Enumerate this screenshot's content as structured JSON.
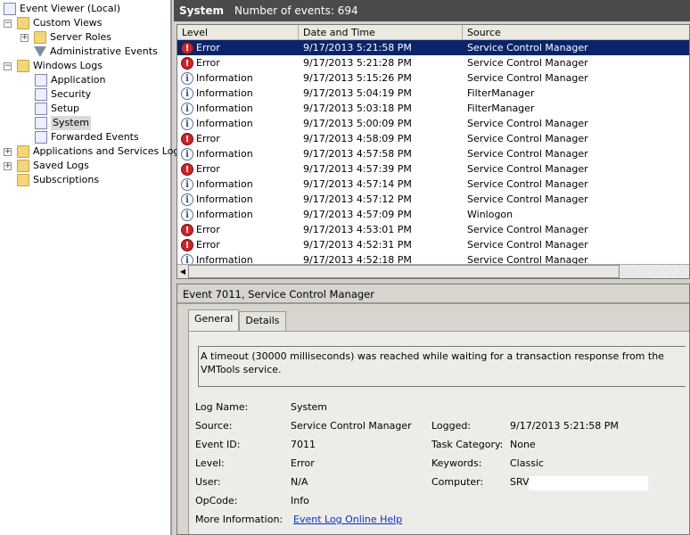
{
  "tree": {
    "root": "Event Viewer (Local)",
    "custom_views": "Custom Views",
    "server_roles": "Server Roles",
    "admin_events": "Administrative Events",
    "windows_logs": "Windows Logs",
    "application": "Application",
    "security": "Security",
    "setup": "Setup",
    "system": "System",
    "forwarded": "Forwarded Events",
    "app_services": "Applications and Services Logs",
    "saved_logs": "Saved Logs",
    "subscriptions": "Subscriptions"
  },
  "header": {
    "title": "System",
    "count": "Number of events: 694"
  },
  "columns": [
    "Level",
    "Date and Time",
    "Source"
  ],
  "events": [
    {
      "level": "Error",
      "time": "9/17/2013 5:21:58 PM",
      "source": "Service Control Manager"
    },
    {
      "level": "Error",
      "time": "9/17/2013 5:21:28 PM",
      "source": "Service Control Manager"
    },
    {
      "level": "Information",
      "time": "9/17/2013 5:15:26 PM",
      "source": "Service Control Manager"
    },
    {
      "level": "Information",
      "time": "9/17/2013 5:04:19 PM",
      "source": "FilterManager"
    },
    {
      "level": "Information",
      "time": "9/17/2013 5:03:18 PM",
      "source": "FilterManager"
    },
    {
      "level": "Information",
      "time": "9/17/2013 5:00:09 PM",
      "source": "Service Control Manager"
    },
    {
      "level": "Error",
      "time": "9/17/2013 4:58:09 PM",
      "source": "Service Control Manager"
    },
    {
      "level": "Information",
      "time": "9/17/2013 4:57:58 PM",
      "source": "Service Control Manager"
    },
    {
      "level": "Error",
      "time": "9/17/2013 4:57:39 PM",
      "source": "Service Control Manager"
    },
    {
      "level": "Information",
      "time": "9/17/2013 4:57:14 PM",
      "source": "Service Control Manager"
    },
    {
      "level": "Information",
      "time": "9/17/2013 4:57:12 PM",
      "source": "Service Control Manager"
    },
    {
      "level": "Information",
      "time": "9/17/2013 4:57:09 PM",
      "source": "Winlogon"
    },
    {
      "level": "Error",
      "time": "9/17/2013 4:53:01 PM",
      "source": "Service Control Manager"
    },
    {
      "level": "Error",
      "time": "9/17/2013 4:52:31 PM",
      "source": "Service Control Manager"
    },
    {
      "level": "Information",
      "time": "9/17/2013 4:52:18 PM",
      "source": "Service Control Manager"
    }
  ],
  "detail": {
    "title": "Event 7011, Service Control Manager",
    "tabs": [
      "General",
      "Details"
    ],
    "message": "A timeout (30000 milliseconds) was reached while waiting for a transaction response from the VMTools service.",
    "fields": {
      "log_name_label": "Log Name:",
      "log_name": "System",
      "source_label": "Source:",
      "source": "Service Control Manager",
      "event_id_label": "Event ID:",
      "event_id": "7011",
      "level_label": "Level:",
      "level": "Error",
      "user_label": "User:",
      "user": "N/A",
      "opcode_label": "OpCode:",
      "opcode": "Info",
      "more_info_label": "More Information:",
      "more_info_link": "Event Log Online Help",
      "logged_label": "Logged:",
      "logged": "9/17/2013 5:21:58 PM",
      "task_label": "Task Category:",
      "task": "None",
      "keywords_label": "Keywords:",
      "keywords": "Classic",
      "computer_label": "Computer:",
      "computer": "SRVI"
    }
  }
}
